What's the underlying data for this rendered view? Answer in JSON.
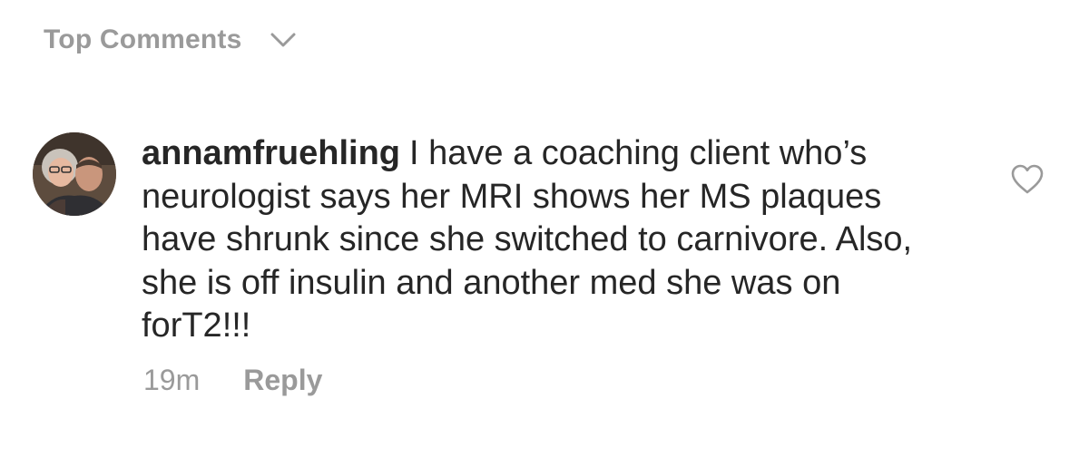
{
  "header": {
    "title": "Top Comments",
    "sort_icon": "chevron-down-icon"
  },
  "comment": {
    "username": "annamfruehling",
    "text": "I have a coaching client who’s neurologist says her MRI shows her MS plaques have shrunk since she switched to carnivore. Also, she is off insulin and another med she was on forT2!!!",
    "time": "19m",
    "reply_label": "Reply",
    "avatar_icon": "avatar",
    "like_icon": "heart-icon"
  },
  "colors": {
    "text": "#262626",
    "muted": "#9a9a9a",
    "background": "#ffffff"
  }
}
